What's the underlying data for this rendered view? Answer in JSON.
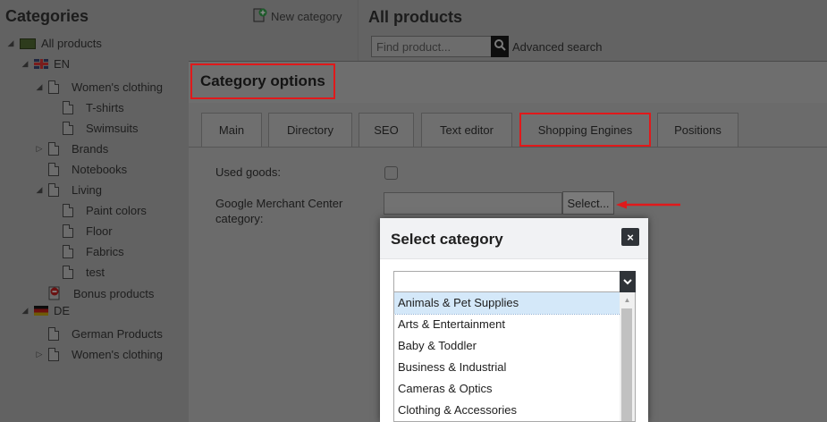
{
  "sidebar": {
    "title": "Categories",
    "new_category": "New category",
    "tree": [
      {
        "label": "All products",
        "expander": "◢",
        "icon": "folder-icon"
      },
      {
        "label": "EN",
        "expander": "◢",
        "icon": "uk-flag-icon"
      },
      {
        "label": "Women's clothing",
        "expander": "◢",
        "icon": "page-icon"
      },
      {
        "label": "T-shirts",
        "expander": "",
        "icon": "page-icon"
      },
      {
        "label": "Swimsuits",
        "expander": "",
        "icon": "page-icon"
      },
      {
        "label": "Brands",
        "expander": "▷",
        "icon": "page-icon"
      },
      {
        "label": "Notebooks",
        "expander": "",
        "icon": "page-icon"
      },
      {
        "label": "Living",
        "expander": "◢",
        "icon": "page-icon"
      },
      {
        "label": "Paint colors",
        "expander": "",
        "icon": "page-icon"
      },
      {
        "label": "Floor",
        "expander": "",
        "icon": "page-icon"
      },
      {
        "label": "Fabrics",
        "expander": "",
        "icon": "page-icon"
      },
      {
        "label": "test",
        "expander": "",
        "icon": "page-icon"
      },
      {
        "label": "Bonus products",
        "expander": "",
        "icon": "bonus-icon"
      },
      {
        "label": "DE",
        "expander": "◢",
        "icon": "de-flag-icon"
      },
      {
        "label": "German Products",
        "expander": "",
        "icon": "page-icon"
      },
      {
        "label": "Women's clothing",
        "expander": "▷",
        "icon": "page-icon"
      }
    ]
  },
  "main": {
    "title": "All products",
    "search_placeholder": "Find product...",
    "advanced_search": "Advanced search"
  },
  "category_options": {
    "title": "Category options",
    "tabs": [
      "Main",
      "Directory",
      "SEO",
      "Text editor",
      "Shopping Engines",
      "Positions"
    ],
    "active_tab": "Shopping Engines",
    "used_goods_label": "Used goods:",
    "used_goods_checked": false,
    "gmc_label_line1": "Google Merchant Center",
    "gmc_label_line2": "category:",
    "gmc_value": "",
    "select_button": "Select..."
  },
  "select_dialog": {
    "title": "Select category",
    "close": "×",
    "selected_value": "",
    "options": [
      "Animals & Pet Supplies",
      "Arts & Entertainment",
      "Baby & Toddler",
      "Business & Industrial",
      "Cameras & Optics",
      "Clothing & Accessories"
    ],
    "highlighted_index": 0
  },
  "colors": {
    "highlight_red": "#e0191b",
    "option_highlight": "#d4e8f9",
    "dialog_header": "#f1f2f4"
  }
}
